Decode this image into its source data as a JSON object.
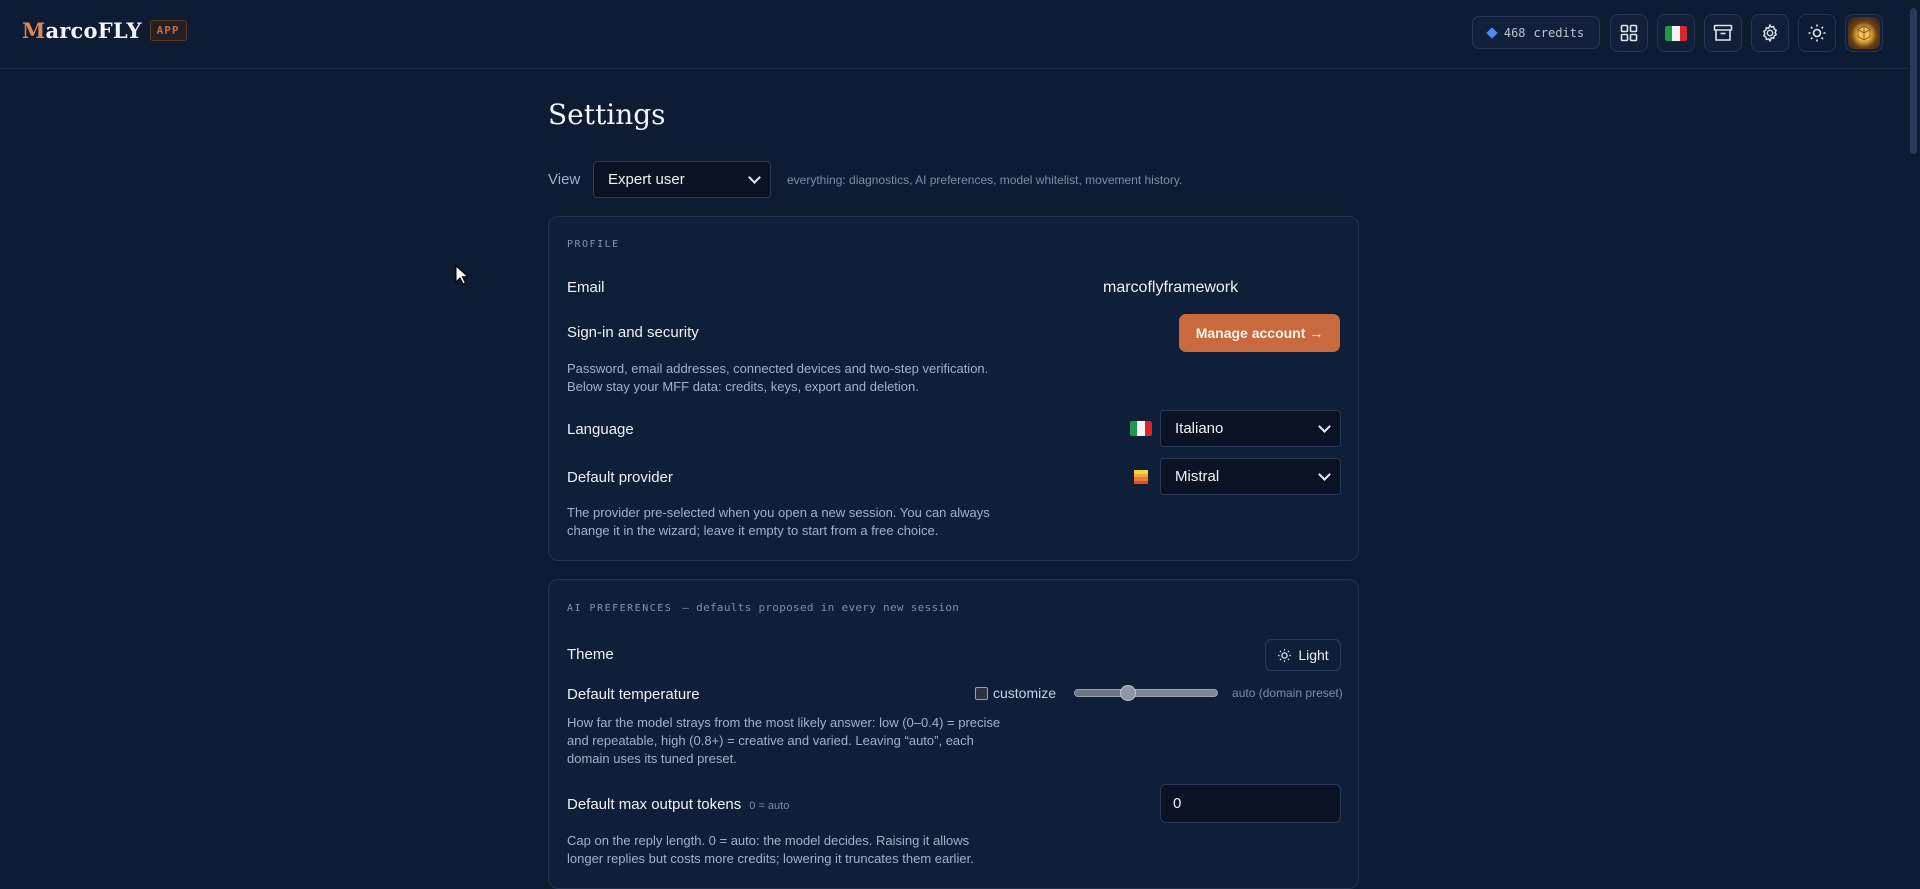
{
  "header": {
    "brand_initial": "M",
    "brand_rest": "arcoFLY",
    "badge": "APP",
    "credits_count": "468",
    "credits_label": "credits",
    "icons": [
      "grid-icon",
      "flag-it-icon",
      "archive-icon",
      "gear-icon",
      "sun-icon",
      "avatar"
    ]
  },
  "page": {
    "title": "Settings",
    "view_label": "View",
    "view_selected": "Expert user",
    "view_hint": "everything: diagnostics, AI preferences, model whitelist, movement history."
  },
  "profile": {
    "section": "PROFILE",
    "email_label": "Email",
    "email_value": "marcoflyframework",
    "signin_label": "Sign-in and security",
    "manage_button": "Manage account →",
    "signin_desc_1": "Password, email addresses, connected devices and two-step verification.",
    "signin_desc_2": "Below stay your MFF data: credits, keys, export and deletion.",
    "language_label": "Language",
    "language_selected": "Italiano",
    "provider_label": "Default provider",
    "provider_selected": "Mistral",
    "provider_desc_1": "The provider pre-selected when you open a new session. You can always",
    "provider_desc_2": "change it in the wizard; leave it empty to start from a free choice."
  },
  "ai": {
    "section": "AI PREFERENCES",
    "section_sub": "— defaults proposed in every new session",
    "theme_label": "Theme",
    "theme_button": "Light",
    "temp_label": "Default temperature",
    "customize_label": "customize",
    "customize_checked": false,
    "temp_slider_fraction": 0.37,
    "temp_auto": "auto (domain preset)",
    "temp_desc_1": "How far the model strays from the most likely answer: low (0–0.4) = precise",
    "temp_desc_2": "and repeatable, high (0.8+) = creative and varied. Leaving “auto”, each",
    "temp_desc_3": "domain uses its tuned preset.",
    "tokens_label": "Default max output tokens",
    "tokens_hint": "0 = auto",
    "tokens_value": "0",
    "tokens_desc_1": "Cap on the reply length. 0 = auto: the model decides. Raising it allows",
    "tokens_desc_2": "longer replies but costs more credits; lowering it truncates them earlier."
  },
  "colors": {
    "background": "#0d1b33",
    "card": "#0f1e39",
    "accent": "#c86a3d",
    "link_blue": "#4e8ef0"
  }
}
